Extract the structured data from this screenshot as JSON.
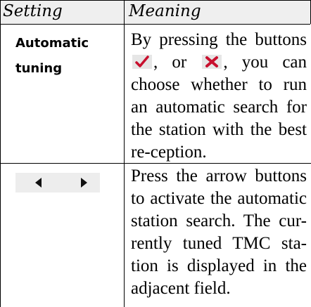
{
  "header": {
    "setting": "Setting",
    "meaning": "Meaning"
  },
  "rows": [
    {
      "setting": "Automatic tuning",
      "meaning_before": "By pressing the buttons",
      "meaning_or": "or",
      "meaning_after": "you can choose whether to run an automatic search for the station with the best re-ception."
    },
    {
      "setting_icons": [
        "arrow-left-icon",
        "arrow-right-icon"
      ],
      "meaning": "Press the arrow buttons to activate the automatic station search. The cur-rently tuned TMC sta-tion is displayed in the adjacent field."
    }
  ],
  "icons": {
    "check": "check-icon",
    "cross": "cross-icon"
  },
  "colors": {
    "check": "#c8102e",
    "cross": "#c8102e",
    "header_bg": "#efefef",
    "button_bg": "#e6e6e6"
  }
}
